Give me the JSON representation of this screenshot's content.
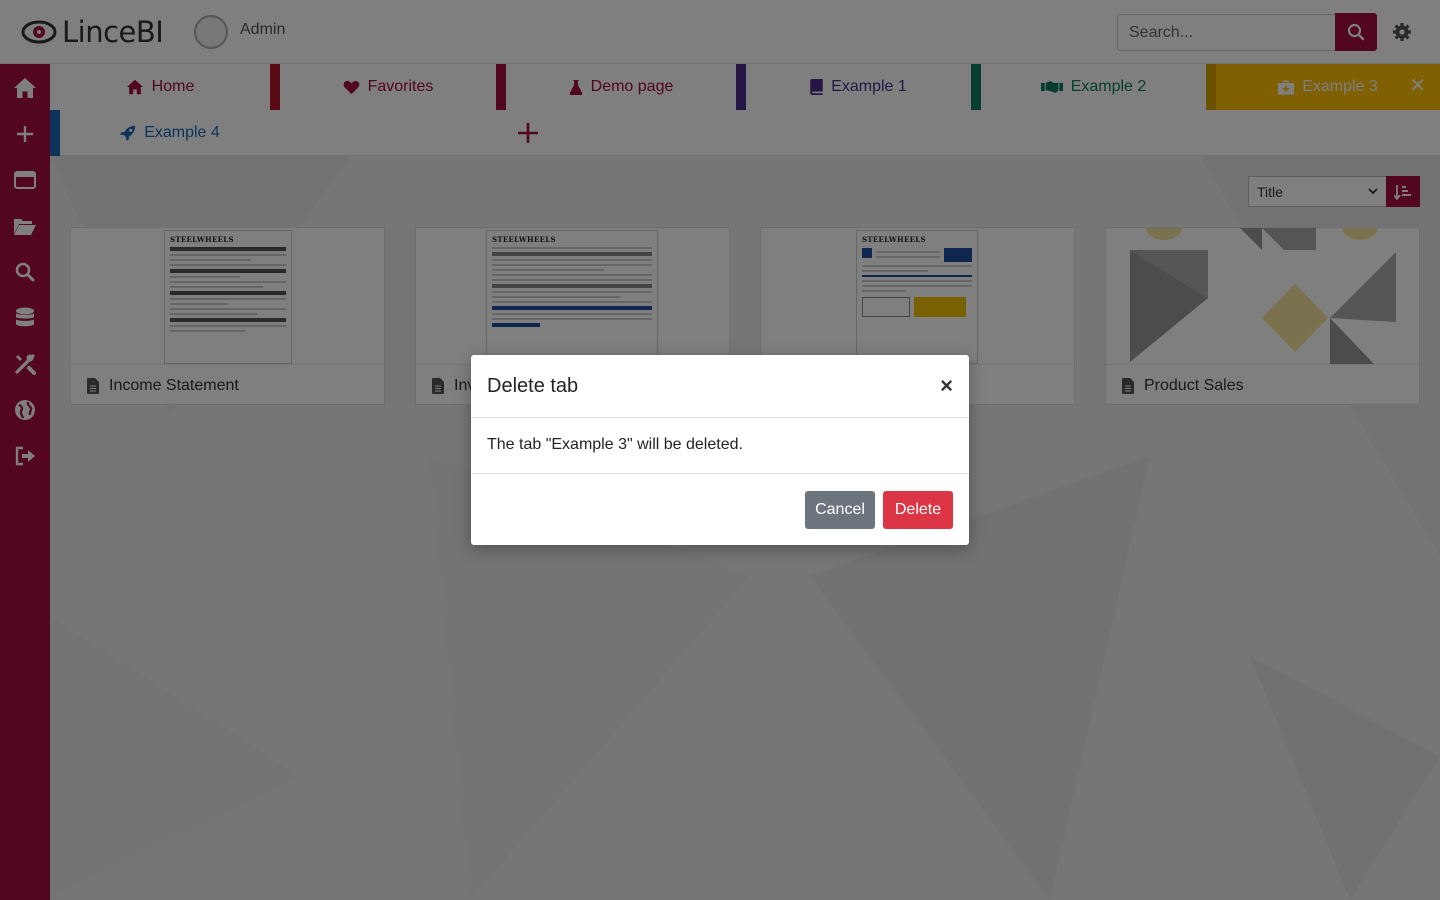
{
  "app": {
    "name": "LinceBI",
    "user": "Admin"
  },
  "search": {
    "placeholder": "Search..."
  },
  "colors": {
    "brand": "#a50d3e",
    "cancel": "#6c757d",
    "delete": "#dc3545"
  },
  "sidebar": {
    "items": [
      {
        "icon": "home-icon"
      },
      {
        "icon": "plus-icon"
      },
      {
        "icon": "window-icon"
      },
      {
        "icon": "folder-open-icon"
      },
      {
        "icon": "search-icon"
      },
      {
        "icon": "database-icon"
      },
      {
        "icon": "tools-icon"
      },
      {
        "icon": "globe-icon"
      },
      {
        "icon": "sign-out-icon"
      }
    ]
  },
  "tabs": [
    {
      "label": "Home",
      "icon": "home-icon",
      "color": "#a50d3e"
    },
    {
      "label": "Favorites",
      "icon": "heart-icon",
      "color": "#a50d3e"
    },
    {
      "label": "Demo page",
      "icon": "flask-icon",
      "color": "#a50d3e"
    },
    {
      "label": "Example 1",
      "icon": "book-icon",
      "color": "#4a2c8a"
    },
    {
      "label": "Example 2",
      "icon": "handshake-icon",
      "color": "#0e7a63"
    },
    {
      "label": "Example 3",
      "icon": "medkit-icon",
      "color": "#ffffff",
      "active": true
    },
    {
      "label": "Example 4",
      "icon": "rocket-icon",
      "color": "#1a66b5"
    }
  ],
  "sort": {
    "selected": "Title"
  },
  "cards": [
    {
      "title": "Income Statement",
      "thumb_header": "STEELWHEELS"
    },
    {
      "title": "Inv",
      "thumb_header": "STEELWHEELS"
    },
    {
      "title": "",
      "thumb_header": "STEELWHEELS"
    },
    {
      "title": "Product Sales"
    }
  ],
  "modal": {
    "title": "Delete tab",
    "close": "×",
    "message": "The tab \"Example 3\" will be deleted.",
    "cancel": "Cancel",
    "delete": "Delete"
  }
}
